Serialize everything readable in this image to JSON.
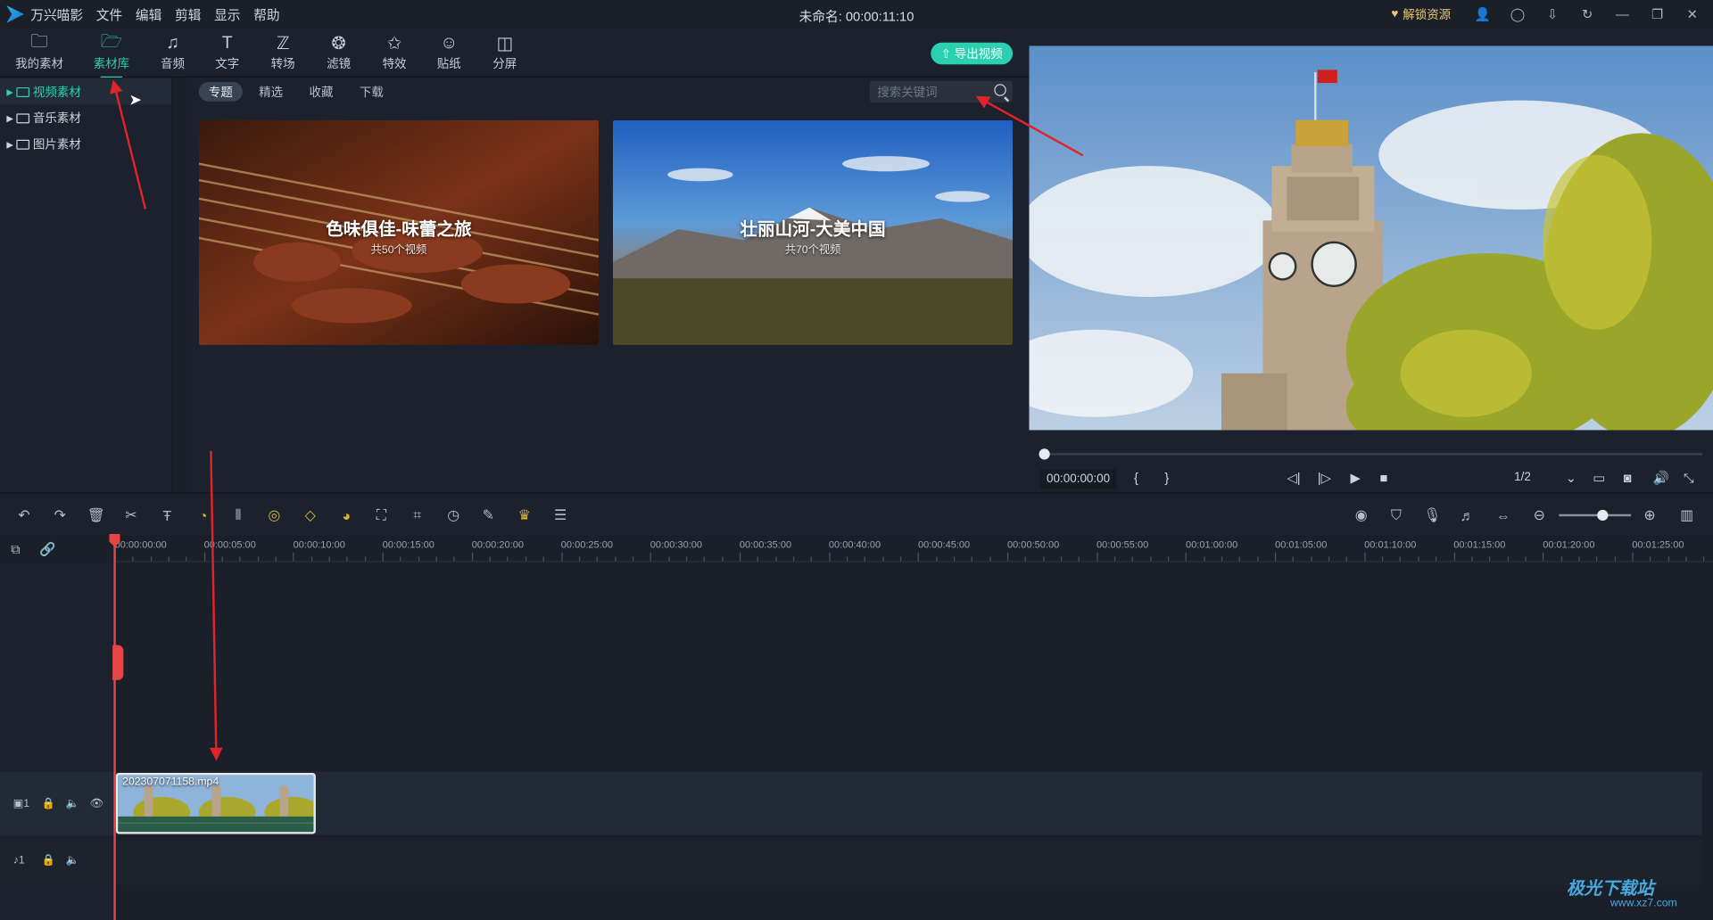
{
  "app": {
    "name": "万兴喵影",
    "doc_title": "未命名: 00:00:11:10",
    "unlock_label": "解锁资源"
  },
  "menu": [
    "文件",
    "编辑",
    "剪辑",
    "显示",
    "帮助"
  ],
  "toolbar": {
    "items": [
      {
        "label": "我的素材",
        "icon": "folder-box-icon"
      },
      {
        "label": "素材库",
        "icon": "folder-icon",
        "active": true
      },
      {
        "label": "音频",
        "icon": "music-note-icon"
      },
      {
        "label": "文字",
        "icon": "text-t-icon"
      },
      {
        "label": "转场",
        "icon": "transition-icon"
      },
      {
        "label": "滤镜",
        "icon": "filter-icon"
      },
      {
        "label": "特效",
        "icon": "effects-icon"
      },
      {
        "label": "贴纸",
        "icon": "sticker-icon"
      },
      {
        "label": "分屏",
        "icon": "split-screen-icon"
      }
    ],
    "export_label": "导出视频"
  },
  "sidebar": {
    "items": [
      {
        "label": "视频素材",
        "selected": true
      },
      {
        "label": "音乐素材"
      },
      {
        "label": "图片素材"
      }
    ]
  },
  "library": {
    "tabs": [
      "专题",
      "精选",
      "收藏",
      "下载"
    ],
    "search_placeholder": "搜索关键词",
    "cards": [
      {
        "title": "色味俱佳-味蕾之旅",
        "subtitle": "共50个视频"
      },
      {
        "title": "壮丽山河-大美中国",
        "subtitle": "共70个视频"
      }
    ]
  },
  "preview": {
    "time": "00:00:00:00",
    "ratio": "1/2",
    "progress": 0
  },
  "timeline": {
    "ticks": [
      "00:00:00:00",
      "00:00:05:00",
      "00:00:10:00",
      "00:00:15:00",
      "00:00:20:00",
      "00:00:25:00",
      "00:00:30:00",
      "00:00:35:00",
      "00:00:40:00",
      "00:00:45:00",
      "00:00:50:00",
      "00:00:55:00",
      "00:01:00:00",
      "00:01:05:00",
      "00:01:10:00",
      "00:01:15:00",
      "00:01:20:00",
      "00:01:25:00"
    ],
    "clip_name": "202307071158.mp4",
    "video_track_label": "1",
    "audio_track_label": "1"
  },
  "watermark": {
    "text": "极光下载站",
    "url": "www.xz7.com"
  }
}
